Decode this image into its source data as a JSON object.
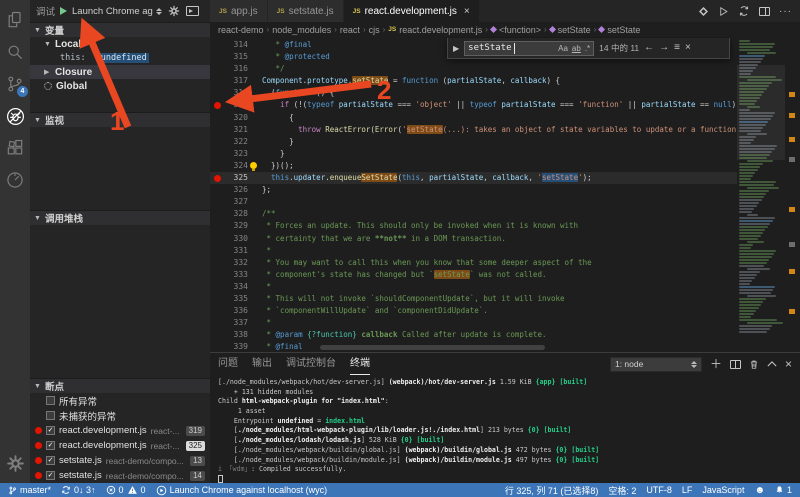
{
  "annotations": {
    "arrow1_label": "1",
    "arrow2_label": "2",
    "color": "#e84722"
  },
  "activity_bar": {
    "scm_badge": "4"
  },
  "debug_toolbar": {
    "title": "调试",
    "config": "Launch Chrome ag"
  },
  "sidebar": {
    "variables": {
      "title": "变量",
      "scopes": [
        {
          "label": "Local"
        },
        {
          "label": "Closure"
        },
        {
          "label": "Global"
        }
      ],
      "this_name": "this:",
      "this_value": "undefined"
    },
    "watch": {
      "title": "监视"
    },
    "call_stack": {
      "title": "调用堆栈"
    },
    "breakpoints": {
      "title": "断点",
      "exceptions": [
        "所有异常",
        "未捕获的异常"
      ],
      "items": [
        {
          "file": "react.development.js",
          "dir": "react-...",
          "line": "319",
          "hit": false
        },
        {
          "file": "react.development.js",
          "dir": "react-...",
          "line": "325",
          "hit": true
        },
        {
          "file": "setstate.js",
          "dir": "react-demo/compo...",
          "line": "13",
          "hit": false
        },
        {
          "file": "setstate.js",
          "dir": "react-demo/compo...",
          "line": "14",
          "hit": false
        }
      ]
    }
  },
  "editor": {
    "js_badge": "JS",
    "tabs": [
      {
        "label": "app.js",
        "active": false
      },
      {
        "label": "setstate.js",
        "active": false
      },
      {
        "label": "react.development.js",
        "active": true,
        "close": "×"
      }
    ],
    "breadcrumb": [
      {
        "label": "react-demo",
        "icon": "none"
      },
      {
        "label": "node_modules",
        "icon": "none"
      },
      {
        "label": "react",
        "icon": "none"
      },
      {
        "label": "cjs",
        "icon": "none"
      },
      {
        "label": "react.development.js",
        "icon": "js"
      },
      {
        "label": "<function>",
        "icon": "sym"
      },
      {
        "label": "setState",
        "icon": "sym"
      },
      {
        "label": "setState",
        "icon": "sym"
      }
    ],
    "find": {
      "query": "setState",
      "case_label": "Aa",
      "word_label": "ab",
      "regex_label": ".*",
      "count": "14 中的 11",
      "prev": "←",
      "next": "→",
      "in_selection": "≡",
      "close": "×"
    },
    "code": {
      "lines": [
        {
          "n": 314,
          "seg": [
            [
              "   * ",
              "cmt"
            ],
            [
              "@final",
              "tag"
            ]
          ]
        },
        {
          "n": 315,
          "seg": [
            [
              "   * ",
              "cmt"
            ],
            [
              "@protected",
              "tag"
            ]
          ]
        },
        {
          "n": 316,
          "seg": [
            [
              "   */",
              "cmt"
            ]
          ]
        },
        {
          "n": 317,
          "seg": [
            [
              "Component",
              "vr"
            ],
            [
              ".",
              "pl"
            ],
            [
              "prototype",
              "vr"
            ],
            [
              ".",
              "pl"
            ],
            [
              "setState",
              "fn match"
            ],
            [
              " = ",
              "pl"
            ],
            [
              "function",
              "kw"
            ],
            [
              " (",
              "pl"
            ],
            [
              "partialState",
              "vr"
            ],
            [
              ", ",
              "pl"
            ],
            [
              "callback",
              "vr"
            ],
            [
              ") {",
              "pl"
            ]
          ]
        },
        {
          "n": 318,
          "seg": [
            [
              "  (",
              "pl"
            ],
            [
              "function",
              "kw"
            ],
            [
              " () {",
              "pl"
            ]
          ]
        },
        {
          "n": 319,
          "bp": true,
          "seg": [
            [
              "    ",
              "pl"
            ],
            [
              "if",
              "ctl"
            ],
            [
              " (!(",
              "pl"
            ],
            [
              "typeof",
              "kw"
            ],
            [
              " ",
              "pl"
            ],
            [
              "partialState",
              "vr"
            ],
            [
              " === ",
              "pl"
            ],
            [
              "'object'",
              "str"
            ],
            [
              " || ",
              "pl"
            ],
            [
              "typeof",
              "kw"
            ],
            [
              " ",
              "pl"
            ],
            [
              "partialState",
              "vr"
            ],
            [
              " === ",
              "pl"
            ],
            [
              "'function'",
              "str"
            ],
            [
              " || ",
              "pl"
            ],
            [
              "partialState",
              "vr"
            ],
            [
              " == ",
              "pl"
            ],
            [
              "null",
              "kw"
            ],
            [
              ")) {",
              "pl"
            ]
          ]
        },
        {
          "n": 320,
          "seg": [
            [
              "      {",
              "pl"
            ]
          ]
        },
        {
          "n": 321,
          "seg": [
            [
              "        ",
              "pl"
            ],
            [
              "throw",
              "ctl"
            ],
            [
              " ",
              "pl"
            ],
            [
              "ReactError",
              "fn"
            ],
            [
              "(",
              "pl"
            ],
            [
              "Error",
              "fn"
            ],
            [
              "(",
              "pl"
            ],
            [
              "'",
              "str"
            ],
            [
              "setState",
              "str match"
            ],
            [
              "(...): takes an object of state variables to update or a function which",
              "str"
            ]
          ]
        },
        {
          "n": 322,
          "seg": [
            [
              "      }",
              "pl"
            ]
          ]
        },
        {
          "n": 323,
          "seg": [
            [
              "    }",
              "pl"
            ]
          ]
        },
        {
          "n": 324,
          "bulb": true,
          "seg": [
            [
              "  })();",
              "pl"
            ]
          ]
        },
        {
          "n": 325,
          "bp": true,
          "cur": true,
          "seg": [
            [
              "  ",
              "pl"
            ],
            [
              "this",
              "kw"
            ],
            [
              ".",
              "pl"
            ],
            [
              "updater",
              "vr"
            ],
            [
              ".",
              "pl"
            ],
            [
              "enqueue",
              "fn"
            ],
            [
              "SetState",
              "fn match"
            ],
            [
              "(",
              "pl"
            ],
            [
              "this",
              "kw"
            ],
            [
              ", ",
              "pl"
            ],
            [
              "partialState",
              "vr"
            ],
            [
              ", ",
              "pl"
            ],
            [
              "callback",
              "vr"
            ],
            [
              ", ",
              "pl"
            ],
            [
              "'",
              "str"
            ],
            [
              "setState",
              "str selhl"
            ],
            [
              "'",
              "str"
            ],
            [
              ");",
              "pl"
            ]
          ]
        },
        {
          "n": 326,
          "seg": [
            [
              "};",
              "pl"
            ]
          ]
        },
        {
          "n": 327,
          "seg": []
        },
        {
          "n": 328,
          "seg": [
            [
              "/**",
              "cmt"
            ]
          ]
        },
        {
          "n": 329,
          "seg": [
            [
              " * Forces an update. This should only be invoked when it is known with",
              "cmt"
            ]
          ]
        },
        {
          "n": 330,
          "seg": [
            [
              " * certainty that we are ",
              "cmt"
            ],
            [
              "**not**",
              "cmtb"
            ],
            [
              " in a DOM transaction.",
              "cmt"
            ]
          ]
        },
        {
          "n": 331,
          "seg": [
            [
              " *",
              "cmt"
            ]
          ]
        },
        {
          "n": 332,
          "seg": [
            [
              " * You may want to call this when you know that some deeper aspect of the",
              "cmt"
            ]
          ]
        },
        {
          "n": 333,
          "seg": [
            [
              " * component's state has changed but `",
              "cmt"
            ],
            [
              "setState",
              "cmt match"
            ],
            [
              "` was not called.",
              "cmt"
            ]
          ]
        },
        {
          "n": 334,
          "seg": [
            [
              " *",
              "cmt"
            ]
          ]
        },
        {
          "n": 335,
          "seg": [
            [
              " * This will not invoke `shouldComponentUpdate`, but it will invoke",
              "cmt"
            ]
          ]
        },
        {
          "n": 336,
          "seg": [
            [
              " * `componentWillUpdate` and `componentDidUpdate`.",
              "cmt"
            ]
          ]
        },
        {
          "n": 337,
          "seg": [
            [
              " *",
              "cmt"
            ]
          ]
        },
        {
          "n": 338,
          "seg": [
            [
              " * ",
              "cmt"
            ],
            [
              "@param",
              "tag"
            ],
            [
              " ",
              "cmt"
            ],
            [
              "{?function}",
              "tag2"
            ],
            [
              " ",
              "cmt"
            ],
            [
              "callback",
              "cmtb"
            ],
            [
              " Called after update is complete.",
              "cmt"
            ]
          ]
        },
        {
          "n": 339,
          "seg": [
            [
              " * ",
              "cmt"
            ],
            [
              "@final",
              "tag"
            ]
          ]
        }
      ]
    }
  },
  "panel": {
    "tabs": [
      {
        "label": "问题",
        "active": false
      },
      {
        "label": "输出",
        "active": false
      },
      {
        "label": "调试控制台",
        "active": false
      },
      {
        "label": "终端",
        "active": true
      }
    ],
    "terminal_select": "1: node",
    "terminal": {
      "lines": [
        [
          [
            "[./node_modules/webpack/hot/dev-server.js] ",
            "t-d"
          ],
          [
            "(webpack)/hot/dev-server.js",
            "t-b"
          ],
          [
            " 1.59 KiB ",
            "t-d"
          ],
          [
            "{app}",
            "t-g"
          ],
          [
            " ",
            "t-d"
          ],
          [
            "[built]",
            "t-g"
          ]
        ],
        [
          [
            "    + 131 hidden modules",
            "t-d"
          ]
        ],
        [
          [
            "Child ",
            "t-d"
          ],
          [
            "html-webpack-plugin for \"index.html\"",
            "t-b"
          ],
          [
            ":",
            "t-d"
          ]
        ],
        [
          [
            "     1 asset",
            "t-d"
          ]
        ],
        [
          [
            "    Entrypoint ",
            "t-d"
          ],
          [
            "undefined",
            "t-b"
          ],
          [
            " = ",
            "t-d"
          ],
          [
            "index.html",
            "t-g"
          ]
        ],
        [
          [
            "    [",
            "t-d"
          ],
          [
            "./node_modules/html-webpack-plugin/lib/loader.js!./index.html",
            "t-b"
          ],
          [
            "] 213 bytes ",
            "t-d"
          ],
          [
            "{0}",
            "t-g"
          ],
          [
            " ",
            "t-d"
          ],
          [
            "[built]",
            "t-g"
          ]
        ],
        [
          [
            "    [",
            "t-d"
          ],
          [
            "./node_modules/lodash/lodash.js",
            "t-b"
          ],
          [
            "] 528 KiB ",
            "t-d"
          ],
          [
            "{0}",
            "t-g"
          ],
          [
            " ",
            "t-d"
          ],
          [
            "[built]",
            "t-g"
          ]
        ],
        [
          [
            "    [./node_modules/webpack/buildin/global.js] ",
            "t-d"
          ],
          [
            "(webpack)/buildin/global.js",
            "t-b"
          ],
          [
            " 472 bytes ",
            "t-d"
          ],
          [
            "{0}",
            "t-g"
          ],
          [
            " ",
            "t-d"
          ],
          [
            "[built]",
            "t-g"
          ]
        ],
        [
          [
            "    [./node_modules/webpack/buildin/module.js] ",
            "t-d"
          ],
          [
            "(webpack)/buildin/module.js",
            "t-b"
          ],
          [
            " 497 bytes ",
            "t-d"
          ],
          [
            "{0}",
            "t-g"
          ],
          [
            " ",
            "t-d"
          ],
          [
            "[built]",
            "t-g"
          ]
        ],
        [
          [
            "i ",
            "t-dim"
          ],
          [
            "「wdm」",
            "t-dim"
          ],
          [
            ": Compiled successfully.",
            "t-d"
          ]
        ]
      ]
    }
  },
  "status_bar": {
    "branch": "master*",
    "sync": "0↓ 3↑",
    "errors": "0",
    "warnings": "0",
    "launch": "Launch Chrome against localhost (wyc)",
    "cursor": "行 325, 列 71 (已选择8)",
    "spaces": "空格: 2",
    "encoding": "UTF-8",
    "eol": "LF",
    "language": "JavaScript",
    "bell_count": "1"
  }
}
